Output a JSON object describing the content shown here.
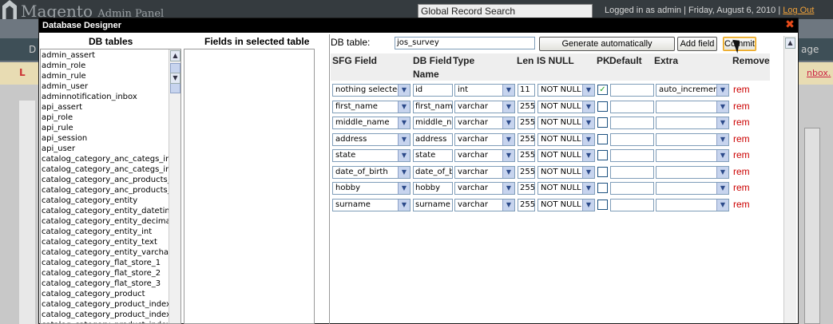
{
  "background": {
    "brand": "Magento",
    "brand_suffix": "Admin Panel",
    "global_search": "Global Record Search",
    "logged_in": "Logged in as admin",
    "date": "Friday, August 6, 2010",
    "separator": "|",
    "logout": "Log Out",
    "nav_ghost_left": "D",
    "nav_ghost_right": "age",
    "msg_ghost": "L",
    "msg_link": "nbox."
  },
  "dialog": {
    "title": "Database Designer",
    "close_icon": "close-icon",
    "db_tables_heading": "DB tables",
    "fields_heading": "Fields in selected table",
    "tables": [
      "admin_assert",
      "admin_role",
      "admin_rule",
      "admin_user",
      "adminnotification_inbox",
      "api_assert",
      "api_role",
      "api_rule",
      "api_session",
      "api_user",
      "catalog_category_anc_categs_ind",
      "catalog_category_anc_categs_ind",
      "catalog_category_anc_products_ir",
      "catalog_category_anc_products_ir",
      "catalog_category_entity",
      "catalog_category_entity_datetime",
      "catalog_category_entity_decimal",
      "catalog_category_entity_int",
      "catalog_category_entity_text",
      "catalog_category_entity_varchar",
      "catalog_category_flat_store_1",
      "catalog_category_flat_store_2",
      "catalog_category_flat_store_3",
      "catalog_category_product",
      "catalog_category_product_index",
      "catalog_category_product_index_",
      "catalog_category_product_index_"
    ],
    "db_table_label": "DB table:",
    "db_table_value": "jos_survey",
    "buttons": {
      "generate": "Generate automatically",
      "add_field": "Add field",
      "commit": "Commit"
    },
    "columns": {
      "sfg_field": "SFG Field",
      "db_field_name_1": "DB Field",
      "db_field_name_2": "Name",
      "type": "Type",
      "len": "Len",
      "is_null": "IS NULL",
      "pk": "PK",
      "default": "Default",
      "extra": "Extra",
      "remove": "Remove"
    },
    "rows": [
      {
        "sfg": "nothing selected",
        "name": "id",
        "type": "int",
        "len": "11",
        "null": "NOT NULL",
        "pk": true,
        "default": "",
        "extra": "auto_increment",
        "rem": "rem"
      },
      {
        "sfg": "first_name",
        "name": "first_name",
        "type": "varchar",
        "len": "255",
        "null": "NOT NULL",
        "pk": false,
        "default": "",
        "extra": "",
        "rem": "rem"
      },
      {
        "sfg": "middle_name",
        "name": "middle_na",
        "type": "varchar",
        "len": "255",
        "null": "NOT NULL",
        "pk": false,
        "default": "",
        "extra": "",
        "rem": "rem"
      },
      {
        "sfg": "address",
        "name": "address",
        "type": "varchar",
        "len": "255",
        "null": "NOT NULL",
        "pk": false,
        "default": "",
        "extra": "",
        "rem": "rem"
      },
      {
        "sfg": "state",
        "name": "state",
        "type": "varchar",
        "len": "255",
        "null": "NOT NULL",
        "pk": false,
        "default": "",
        "extra": "",
        "rem": "rem"
      },
      {
        "sfg": "date_of_birth",
        "name": "date_of_b",
        "type": "varchar",
        "len": "255",
        "null": "NOT NULL",
        "pk": false,
        "default": "",
        "extra": "",
        "rem": "rem"
      },
      {
        "sfg": "hobby",
        "name": "hobby",
        "type": "varchar",
        "len": "255",
        "null": "NOT NULL",
        "pk": false,
        "default": "",
        "extra": "",
        "rem": "rem"
      },
      {
        "sfg": "surname",
        "name": "surname",
        "type": "varchar",
        "len": "255",
        "null": "NOT NULL",
        "pk": false,
        "default": "",
        "extra": "",
        "rem": "rem"
      }
    ]
  }
}
